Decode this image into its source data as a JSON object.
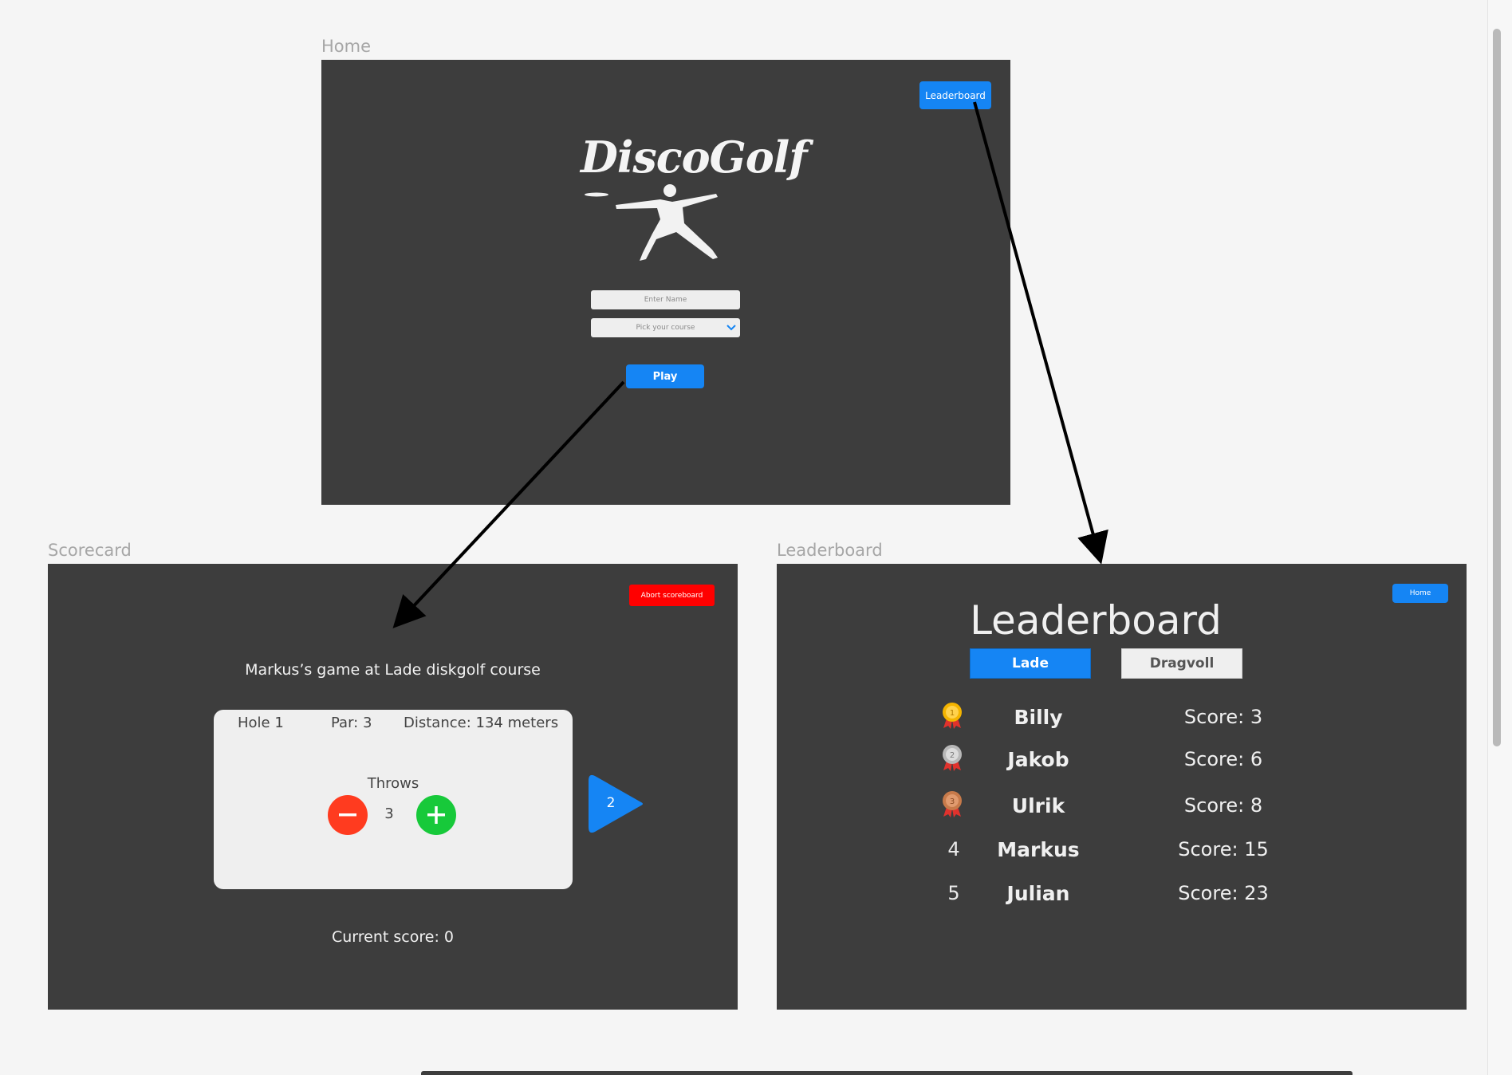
{
  "frames": {
    "home": {
      "label": "Home"
    },
    "scorecard": {
      "label": "Scorecard"
    },
    "leaderboard": {
      "label": "Leaderboard"
    }
  },
  "home": {
    "leaderboard_button": "Leaderboard",
    "logo_text": "DiscoGolf",
    "name_placeholder": "Enter Name",
    "course_select": "Pick your course",
    "play_button": "Play"
  },
  "scorecard": {
    "abort_button": "Abort scoreboard",
    "game_title": "Markus’s game at Lade diskgolf course",
    "hole": "Hole 1",
    "par": "Par: 3",
    "distance": "Distance: 134 meters",
    "throws_label": "Throws",
    "throws_value": "3",
    "next_hole": "2",
    "current_score": "Current score: 0"
  },
  "leaderboard": {
    "home_button": "Home",
    "title": "Leaderboard",
    "tabs": [
      {
        "label": "Lade",
        "active": true
      },
      {
        "label": "Dragvoll",
        "active": false
      }
    ],
    "rows": [
      {
        "rank": "1",
        "name": "Billy",
        "score": "Score: 3",
        "medal": "gold"
      },
      {
        "rank": "2",
        "name": "Jakob",
        "score": "Score: 6",
        "medal": "silver"
      },
      {
        "rank": "3",
        "name": "Ulrik",
        "score": "Score: 8",
        "medal": "bronze"
      },
      {
        "rank": "4",
        "name": "Markus",
        "score": "Score: 15",
        "medal": ""
      },
      {
        "rank": "5",
        "name": "Julian",
        "score": "Score: 23",
        "medal": ""
      }
    ]
  },
  "colors": {
    "frame_bg": "#3d3d3d",
    "canvas_bg": "#f5f5f5",
    "accent_blue": "#1585f4",
    "abort_red": "#ff0000",
    "minus_red": "#ff3b1f",
    "plus_green": "#17c93a",
    "gold": "#f4b400",
    "silver": "#b8b8b8",
    "bronze": "#c77a4a"
  },
  "icons": {
    "dropdown": "chevron-down-icon",
    "minus": "minus-icon",
    "plus": "plus-icon",
    "next": "play-triangle-icon",
    "medal": "medal-icon",
    "logo_figure": "disc-thrower-icon"
  }
}
